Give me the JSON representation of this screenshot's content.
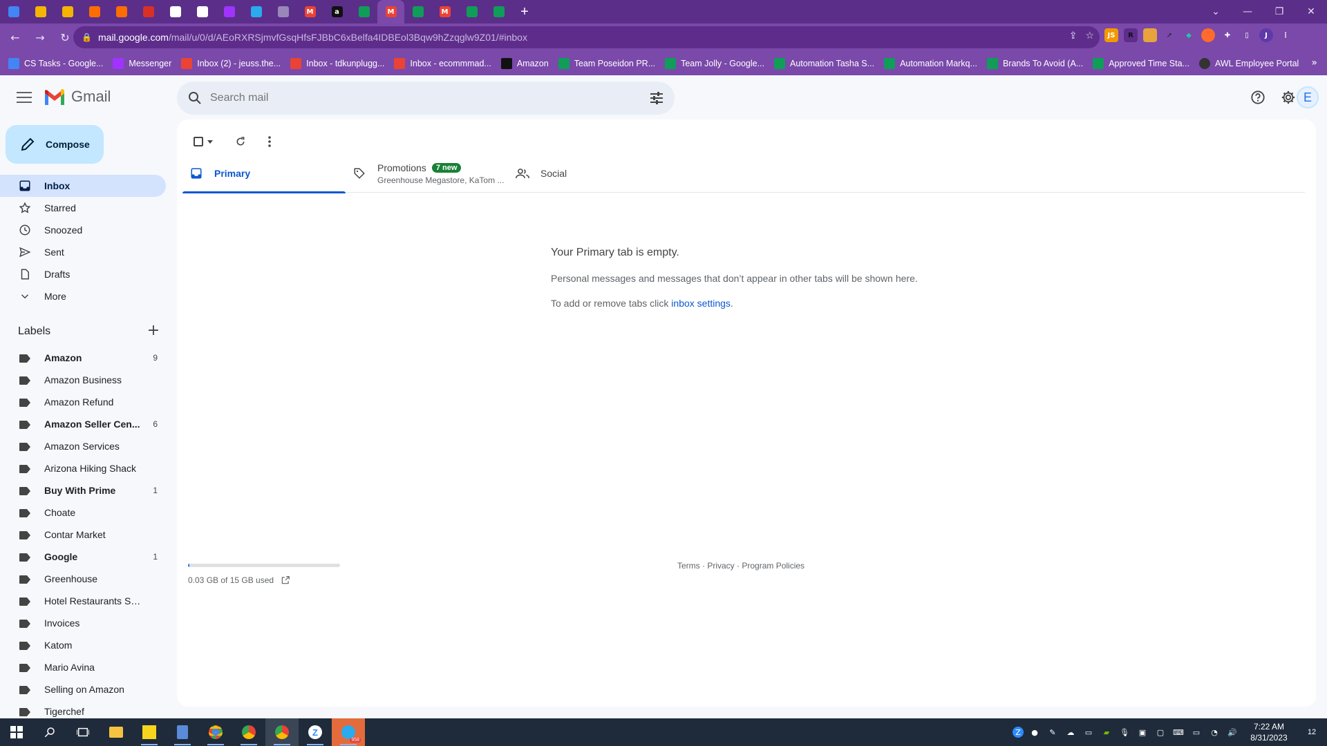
{
  "browser": {
    "tabs": [
      {
        "icon": "docs-icon",
        "color": "#4285f4",
        "glyph": ""
      },
      {
        "icon": "drive-icon",
        "color": "#f4b400",
        "glyph": ""
      },
      {
        "icon": "drive-icon",
        "color": "#f4b400",
        "glyph": ""
      },
      {
        "icon": "bolt-icon",
        "color": "#ff6d00",
        "glyph": ""
      },
      {
        "icon": "bolt-icon",
        "color": "#ff6d00",
        "glyph": ""
      },
      {
        "icon": "dash-icon",
        "color": "#d93025",
        "glyph": ""
      },
      {
        "icon": "notion-icon",
        "color": "#ffffff",
        "glyph": ""
      },
      {
        "icon": "notion-icon",
        "color": "#ffffff",
        "glyph": ""
      },
      {
        "icon": "messenger-icon",
        "color": "#a033ff",
        "glyph": ""
      },
      {
        "icon": "telegram-icon",
        "color": "#2aabee",
        "glyph": ""
      },
      {
        "icon": "signature-icon",
        "color": "#9a86b8",
        "glyph": ""
      },
      {
        "icon": "gmail-icon",
        "color": "#ea4335",
        "glyph": "M"
      },
      {
        "icon": "amazon-icon",
        "color": "#111111",
        "glyph": "a"
      },
      {
        "icon": "sheets-icon",
        "color": "#0f9d58",
        "glyph": ""
      },
      {
        "icon": "gmail-icon",
        "color": "#ea4335",
        "glyph": "M",
        "active": true
      },
      {
        "icon": "sheets-icon",
        "color": "#0f9d58",
        "glyph": ""
      },
      {
        "icon": "gmail-icon",
        "color": "#ea4335",
        "glyph": "M"
      },
      {
        "icon": "sheets-icon",
        "color": "#0f9d58",
        "glyph": ""
      },
      {
        "icon": "sheets-icon",
        "color": "#0f9d58",
        "glyph": ""
      }
    ],
    "new_tab": "+",
    "url_host": "mail.google.com",
    "url_path": "/mail/u/0/d/AEoRXRSjmvfGsqHfsFJBbC6xBelfa4IDBEol3Bqw9hZzqglw9Z01/#inbox",
    "bookmarks": [
      {
        "label": "CS Tasks - Google...",
        "icon": "docs-icon",
        "color": "#4285f4"
      },
      {
        "label": "Messenger",
        "icon": "messenger-icon",
        "color": "#a033ff"
      },
      {
        "label": "Inbox (2) - jeuss.the...",
        "icon": "gmail-icon",
        "color": "#ea4335"
      },
      {
        "label": "Inbox - tdkunplugg...",
        "icon": "gmail-icon",
        "color": "#ea4335"
      },
      {
        "label": "Inbox - ecommmad...",
        "icon": "gmail-icon",
        "color": "#ea4335"
      },
      {
        "label": "Amazon",
        "icon": "amazon-icon",
        "color": "#111111"
      },
      {
        "label": "Team Poseidon PR...",
        "icon": "sheets-icon",
        "color": "#0f9d58"
      },
      {
        "label": "Team Jolly - Google...",
        "icon": "sheets-icon",
        "color": "#0f9d58"
      },
      {
        "label": "Automation Tasha S...",
        "icon": "sheets-icon",
        "color": "#0f9d58"
      },
      {
        "label": "Automation Markq...",
        "icon": "sheets-icon",
        "color": "#0f9d58"
      },
      {
        "label": "Brands To Avoid (A...",
        "icon": "sheets-icon",
        "color": "#0f9d58"
      },
      {
        "label": "Approved Time Sta...",
        "icon": "sheets-icon",
        "color": "#0f9d58"
      },
      {
        "label": "AWL Employee Portal",
        "icon": "awl-icon",
        "color": "#333333"
      }
    ],
    "profile_initial": "J"
  },
  "gmail": {
    "app_name": "Gmail",
    "search_placeholder": "Search mail",
    "avatar_initial": "E",
    "compose_label": "Compose",
    "nav": [
      {
        "label": "Inbox",
        "icon": "inbox-icon",
        "active": true
      },
      {
        "label": "Starred",
        "icon": "star-icon"
      },
      {
        "label": "Snoozed",
        "icon": "clock-icon"
      },
      {
        "label": "Sent",
        "icon": "send-icon"
      },
      {
        "label": "Drafts",
        "icon": "draft-icon"
      },
      {
        "label": "More",
        "icon": "chevron-down-icon"
      }
    ],
    "labels_heading": "Labels",
    "labels": [
      {
        "label": "Amazon",
        "count": "9",
        "bold": true
      },
      {
        "label": "Amazon Business",
        "count": ""
      },
      {
        "label": "Amazon Refund",
        "count": ""
      },
      {
        "label": "Amazon Seller Cen...",
        "count": "6",
        "bold": true
      },
      {
        "label": "Amazon Services",
        "count": ""
      },
      {
        "label": "Arizona Hiking Shack",
        "count": ""
      },
      {
        "label": "Buy With Prime",
        "count": "1",
        "bold": true
      },
      {
        "label": "Choate",
        "count": ""
      },
      {
        "label": "Contar Market",
        "count": ""
      },
      {
        "label": "Google",
        "count": "1",
        "bold": true
      },
      {
        "label": "Greenhouse",
        "count": ""
      },
      {
        "label": "Hotel Restaurants Supply",
        "count": ""
      },
      {
        "label": "Invoices",
        "count": ""
      },
      {
        "label": "Katom",
        "count": ""
      },
      {
        "label": "Mario Avina",
        "count": ""
      },
      {
        "label": "Selling on Amazon",
        "count": ""
      },
      {
        "label": "Tigerchef",
        "count": ""
      }
    ],
    "tabs": {
      "primary": "Primary",
      "promotions": "Promotions",
      "promotions_badge": "7 new",
      "promotions_sub": "Greenhouse Megastore, KaTom ...",
      "social": "Social"
    },
    "empty": {
      "heading": "Your Primary tab is empty.",
      "text": "Personal messages and messages that don’t appear in other tabs will be shown here.",
      "settings_prefix": "To add or remove tabs click ",
      "settings_link": "inbox settings",
      "settings_suffix": "."
    },
    "storage": {
      "text": "0.03 GB of 15 GB used",
      "fraction": 0.002
    },
    "footer": {
      "terms": "Terms",
      "sep1": " · ",
      "privacy": "Privacy",
      "sep2": " · ",
      "policies": "Program Policies"
    }
  },
  "taskbar": {
    "time": "7:22 AM",
    "date": "8/31/2023",
    "notification_count": "12",
    "telegram_badge": "958"
  },
  "colors": {
    "brand_purple": "#7a49aa",
    "accent_blue": "#0b57d0",
    "selected_nav": "#d3e3fd",
    "compose_bg": "#c2e7ff",
    "badge_green": "#188038"
  }
}
